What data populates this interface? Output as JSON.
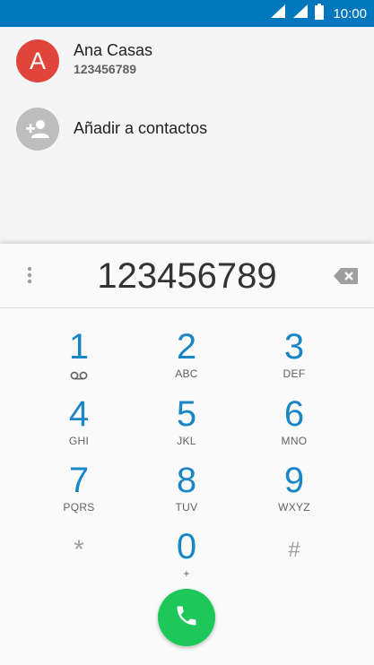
{
  "status_bar": {
    "time": "10:00",
    "icons": [
      "wifi-icon",
      "signal-icon",
      "battery-icon"
    ]
  },
  "suggestions": {
    "contact": {
      "initial": "A",
      "name": "Ana Casas",
      "number": "123456789",
      "avatar_color": "#e0453b"
    },
    "add_contact": {
      "label": "Añadir a contactos",
      "icon": "add-person-icon"
    }
  },
  "dialpad": {
    "digits": "123456789",
    "keys": [
      {
        "digit": "1",
        "letters": "",
        "sub_icon": "voicemail-icon"
      },
      {
        "digit": "2",
        "letters": "ABC"
      },
      {
        "digit": "3",
        "letters": "DEF"
      },
      {
        "digit": "4",
        "letters": "GHI"
      },
      {
        "digit": "5",
        "letters": "JKL"
      },
      {
        "digit": "6",
        "letters": "MNO"
      },
      {
        "digit": "7",
        "letters": "PQRS"
      },
      {
        "digit": "8",
        "letters": "TUV"
      },
      {
        "digit": "9",
        "letters": "WXYZ"
      },
      {
        "digit": "*",
        "letters": ""
      },
      {
        "digit": "0",
        "letters": "+"
      },
      {
        "digit": "#",
        "letters": ""
      }
    ],
    "accent_color": "#1a86c6",
    "call_button_color": "#1ec75a"
  }
}
